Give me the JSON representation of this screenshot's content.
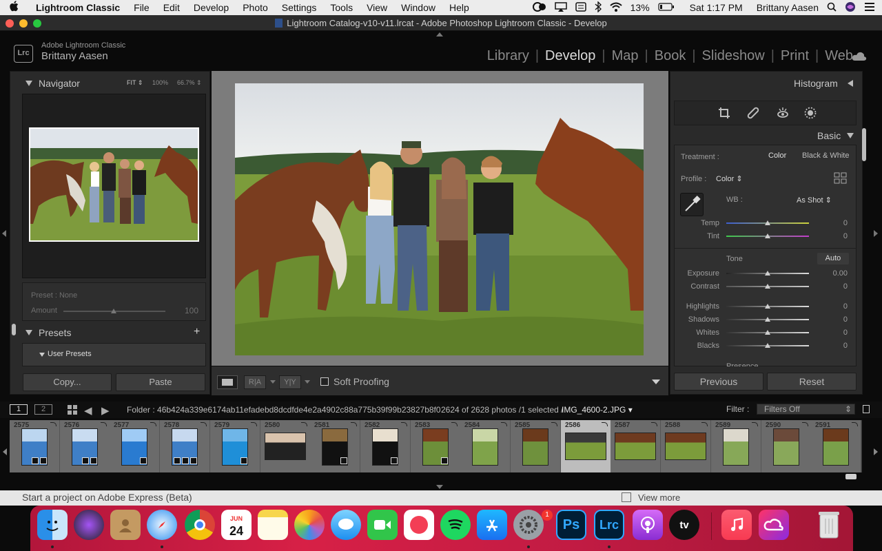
{
  "menubar": {
    "apple": "",
    "app": "Lightroom Classic",
    "items": [
      "File",
      "Edit",
      "Develop",
      "Photo",
      "Settings",
      "Tools",
      "View",
      "Window",
      "Help"
    ],
    "battery": "13%",
    "clock": "Sat 1:17 PM",
    "user": "Brittany Aasen"
  },
  "window": {
    "title": "Lightroom Catalog-v10-v11.lrcat - Adobe Photoshop Lightroom Classic - Develop"
  },
  "identity": {
    "logo": "Lrc",
    "product": "Adobe Lightroom Classic",
    "user": "Brittany Aasen"
  },
  "modules": [
    "Library",
    "Develop",
    "Map",
    "Book",
    "Slideshow",
    "Print",
    "Web"
  ],
  "active_module": "Develop",
  "navigator": {
    "title": "Navigator",
    "fit": "FIT",
    "z1": "100%",
    "z2": "66.7%"
  },
  "preset_amount": {
    "preset": "Preset : None",
    "amount_label": "Amount",
    "amount_value": "100",
    "amount_level": 0.5
  },
  "presets": {
    "title": "Presets",
    "group": "User Presets",
    "add": "+"
  },
  "left_buttons": {
    "copy": "Copy...",
    "paste": "Paste"
  },
  "toolbar": {
    "soft_proofing": "Soft Proofing"
  },
  "histogram": {
    "title": "Histogram"
  },
  "basic": {
    "title": "Basic",
    "treatment_label": "Treatment :",
    "treatment_color": "Color",
    "treatment_bw": "Black & White",
    "profile_label": "Profile :",
    "profile_value": "Color",
    "wb_label": "WB :",
    "wb_value": "As Shot",
    "temp": {
      "label": "Temp",
      "value": "0"
    },
    "tint": {
      "label": "Tint",
      "value": "0"
    },
    "tone_label": "Tone",
    "auto": "Auto",
    "exposure": {
      "label": "Exposure",
      "value": "0.00"
    },
    "contrast": {
      "label": "Contrast",
      "value": "0"
    },
    "highlights": {
      "label": "Highlights",
      "value": "0"
    },
    "shadows": {
      "label": "Shadows",
      "value": "0"
    },
    "whites": {
      "label": "Whites",
      "value": "0"
    },
    "blacks": {
      "label": "Blacks",
      "value": "0"
    },
    "presence_label": "Presence"
  },
  "right_buttons": {
    "previous": "Previous",
    "reset": "Reset"
  },
  "filmbar": {
    "page1": "1",
    "page2": "2",
    "folder": "Folder : 46b424a339e6174ab11efadebd8dcdfde4e2a4902c88a775b39f99b23827b8f0",
    "count": "2624 of 2628 photos /1 selected /",
    "file": "IMG_4600-2.JPG",
    "filter_label": "Filter :",
    "filter_value": "Filters Off"
  },
  "filmstrip": [
    "2575",
    "2576",
    "2577",
    "2578",
    "2579",
    "2580",
    "2581",
    "2582",
    "2583",
    "2584",
    "2585",
    "2586",
    "2587",
    "2588",
    "2589",
    "2590",
    "2591"
  ],
  "selected_index": 11,
  "express": {
    "text": "Start a project on Adobe Express (Beta)",
    "more": "View more"
  },
  "dock": {
    "calendar_month": "JUN",
    "calendar_day": "24",
    "badge": "1",
    "ps": "Ps",
    "lrc": "Lrc",
    "tv": "tv"
  },
  "colors": {
    "dock": "#c81c42",
    "lr_bg": "#2a2a2a",
    "canvas": "#7c7c7c"
  }
}
